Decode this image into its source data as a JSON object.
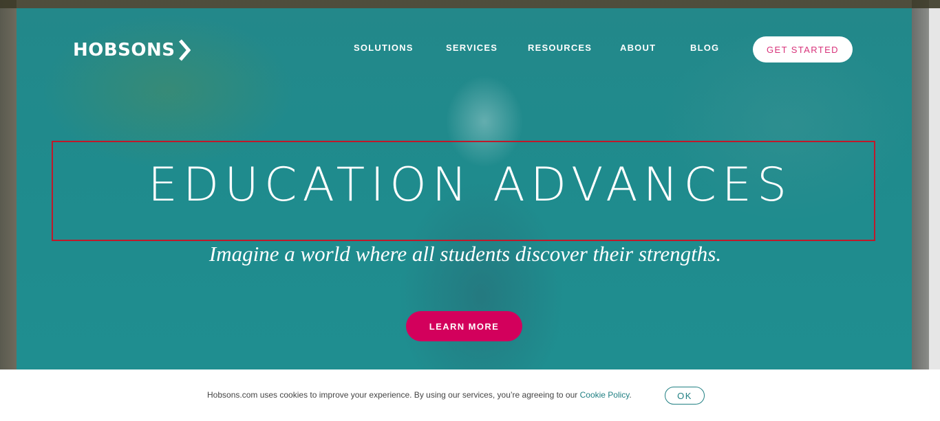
{
  "brand": {
    "name": "HOBSONS"
  },
  "nav": {
    "items": [
      {
        "label": "SOLUTIONS"
      },
      {
        "label": "SERVICES"
      },
      {
        "label": "RESOURCES"
      },
      {
        "label": "ABOUT"
      },
      {
        "label": "BLOG"
      }
    ],
    "cta_label": "GET STARTED"
  },
  "hero": {
    "headline": "EDUCATION ADVANCES",
    "subheadline": "Imagine a world where all students discover their strengths.",
    "button_label": "LEARN MORE"
  },
  "cookie_notice": {
    "text_before": "Hobsons.com uses cookies to improve your experience. By using our services, you’re agreeing to our ",
    "link_label": "Cookie Policy",
    "text_after": ".",
    "ok_label": "OK"
  },
  "colors": {
    "hero_teal": "#1f8b8d",
    "accent_pink": "#d3005c",
    "cta_text_pink": "#d8327a",
    "highlight_box": "#c0182a"
  }
}
